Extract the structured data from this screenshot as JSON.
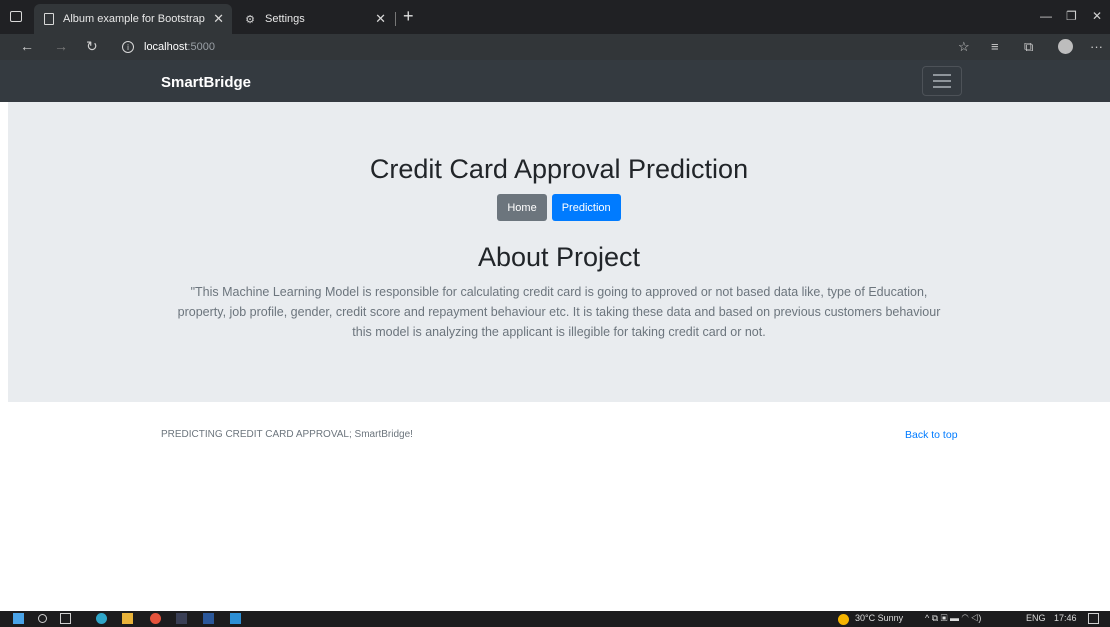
{
  "browser": {
    "tabs": [
      {
        "title": "Album example for Bootstrap",
        "active": true
      },
      {
        "title": "Settings",
        "active": false
      }
    ],
    "url_host": "localhost",
    "url_port": ":5000"
  },
  "navbar": {
    "brand": "SmartBridge"
  },
  "hero": {
    "title": "Credit Card Approval Prediction",
    "buttons": {
      "home": "Home",
      "prediction": "Prediction"
    },
    "about_title": "About Project",
    "about_text": "\"This Machine Learning Model is responsible for calculating credit card is going to approved or not based data like, type of Education, property, job profile, gender, credit score and repayment behaviour etc. It is taking these data and based on previous customers behaviour this model is analyzing the applicant is illegible for taking credit card or not."
  },
  "footer": {
    "text": "PREDICTING CREDIT CARD APPROVAL; SmartBridge!",
    "back_to_top": "Back to top"
  },
  "taskbar": {
    "weather": "30°C  Sunny",
    "language": "ENG",
    "time": "17:46"
  },
  "colors": {
    "navbar_bg": "#343a40",
    "jumbotron_bg": "#e9ecef",
    "primary": "#007bff",
    "secondary": "#6c757d"
  }
}
